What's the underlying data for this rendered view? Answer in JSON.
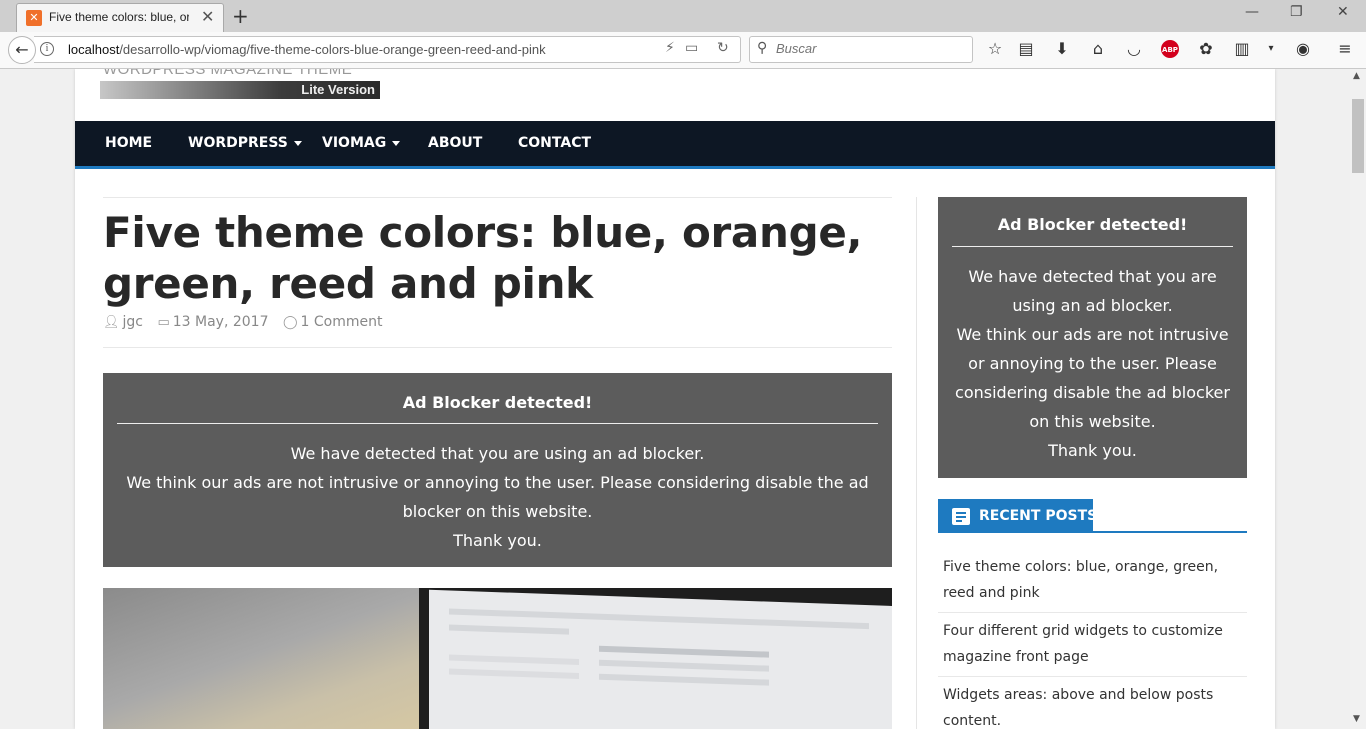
{
  "browser": {
    "tab_title": "Five theme colors: blue, orar",
    "tab_close": "✕",
    "new_tab": "+",
    "url_host": "localhost",
    "url_path": "/desarrollo-wp/viomag/five-theme-colors-blue-orange-green-reed-and-pink",
    "search_placeholder": "Buscar",
    "window_controls": [
      "—",
      "❐",
      "✕"
    ],
    "extension_abp": "ABP"
  },
  "site": {
    "logo_text": "WORDPRESS MAGAZINE THEME",
    "logo_sub": "Lite Version",
    "accent_color": "#1e7ac0",
    "nav": [
      {
        "label": "HOME",
        "dropdown": false
      },
      {
        "label": "WORDPRESS",
        "dropdown": true
      },
      {
        "label": "VIOMAG",
        "dropdown": true
      },
      {
        "label": "ABOUT",
        "dropdown": false
      },
      {
        "label": "CONTACT",
        "dropdown": false
      }
    ]
  },
  "post": {
    "title": "Five theme colors: blue, orange, green, reed and pink",
    "author": "jgc",
    "date": "13 May, 2017",
    "comments": "1 Comment"
  },
  "ad_main": {
    "heading": "Ad Blocker detected!",
    "line1": "We have detected that you are using an ad blocker.",
    "line2": "We think our ads are not intrusive or annoying to the user. Please considering disable the ad blocker on this website.",
    "line3": "Thank you."
  },
  "ad_side": {
    "heading": "Ad Blocker detected!",
    "line1": "We have detected that you are using an ad blocker.",
    "line2": "We think our ads are not intrusive or annoying to the user. Please considering disable the ad blocker on this website.",
    "line3": "Thank you."
  },
  "recent_posts": {
    "heading": "RECENT POSTS",
    "items": [
      "Five theme colors: blue, orange, green, reed and pink",
      "Four different grid widgets to customize magazine front page",
      "Widgets areas: above and below posts content."
    ]
  }
}
